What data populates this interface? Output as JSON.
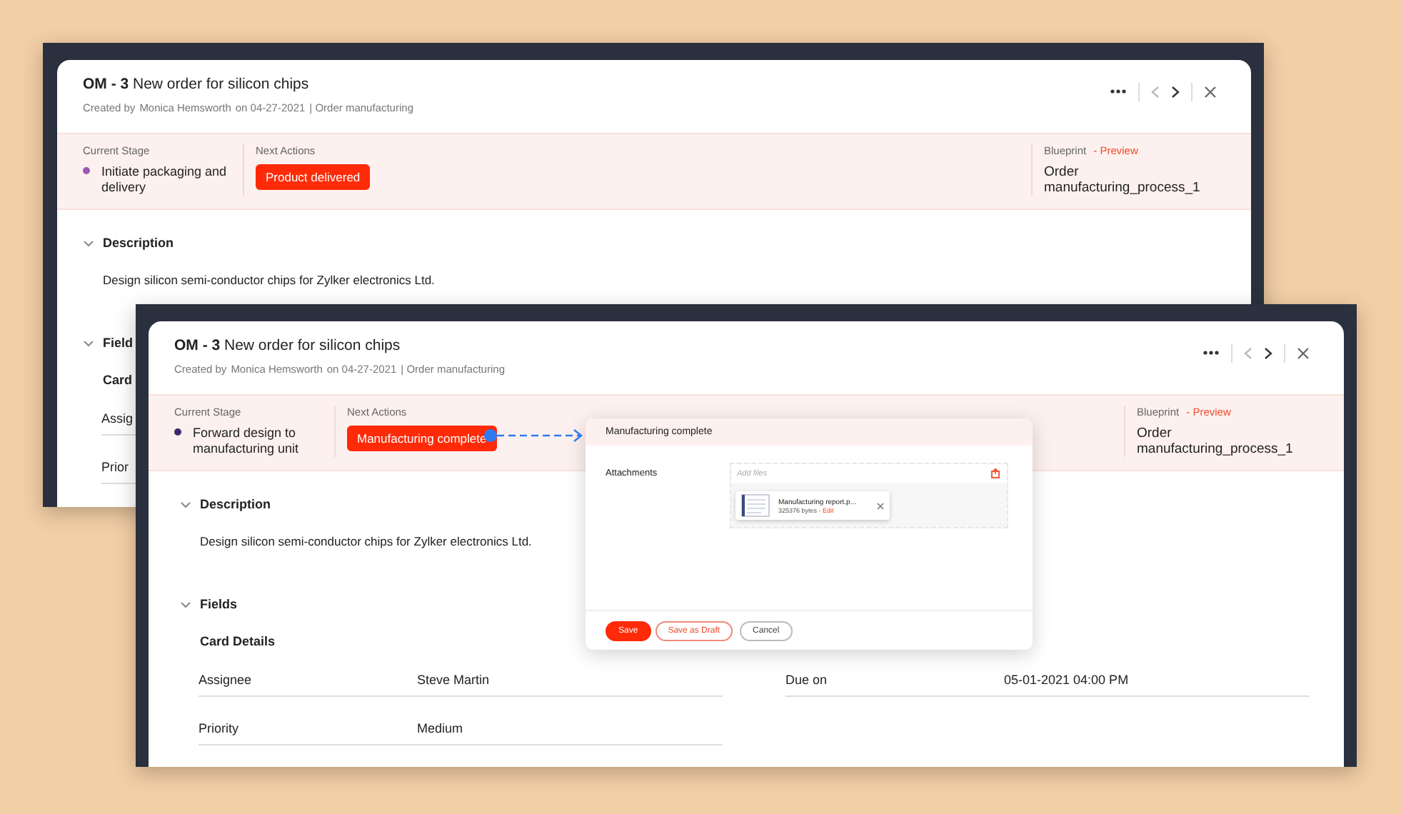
{
  "windows": [
    {
      "record_id": "OM - 3",
      "title": "New order for silicon chips",
      "created_label": "Created by",
      "creator": "Monica Hemsworth",
      "created_on": "on 04-27-2021",
      "module": "| Order manufacturing",
      "previous_disabled": true,
      "current_stage_label": "Current Stage",
      "stage": {
        "name": "Initiate packaging and delivery",
        "color": "#9b59b6"
      },
      "next_actions_label": "Next Actions",
      "actions": [
        "Product delivered"
      ],
      "blueprint_label": "Blueprint",
      "preview_link": "- Preview",
      "blueprint": "Order manufacturing_process_1",
      "sections": [
        {
          "title": "Description",
          "expanded": true,
          "text": "Design silicon semi-conductor chips for Zylker electronics Ltd."
        },
        {
          "title": "Field",
          "expanded": true,
          "subheading": "Card",
          "fields": [
            {
              "label": "Assig"
            },
            {
              "label": "Prior"
            }
          ]
        }
      ]
    },
    {
      "record_id": "OM - 3",
      "title": "New order for silicon chips",
      "created_label": "Created by",
      "creator": "Monica Hemsworth",
      "created_on": "on 04-27-2021",
      "module": "| Order manufacturing",
      "previous_disabled": true,
      "current_stage_label": "Current Stage",
      "stage": {
        "name": "Forward design to manufacturing unit",
        "color": "#3b2a6b"
      },
      "next_actions_label": "Next Actions",
      "actions": [
        "Manufacturing complete"
      ],
      "blueprint_label": "Blueprint",
      "preview_link": "- Preview",
      "blueprint": "Order manufacturing_process_1",
      "sections": [
        {
          "title": "Description",
          "expanded": true,
          "text": "Design silicon semi-conductor chips for Zylker electronics Ltd."
        },
        {
          "title": "Fields",
          "expanded": true,
          "subheading": "Card Details",
          "fields": [
            {
              "label": "Assignee",
              "value": "Steve Martin"
            },
            {
              "label": "Due on",
              "value": "05-01-2021 04:00 PM"
            },
            {
              "label": "Priority",
              "value": "Medium"
            }
          ]
        }
      ],
      "dialog": {
        "title": "Manufacturing complete",
        "attachments_label": "Attachments",
        "placeholder": "Add files",
        "files": [
          {
            "name": "Manufacturing report.p...",
            "size": "325376 bytes",
            "edit": "- Edit"
          }
        ],
        "buttons": [
          {
            "label": "Save",
            "kind": "primary"
          },
          {
            "label": "Save as Draft",
            "kind": "secondary"
          },
          {
            "label": "Cancel",
            "kind": "plain"
          }
        ]
      }
    }
  ]
}
